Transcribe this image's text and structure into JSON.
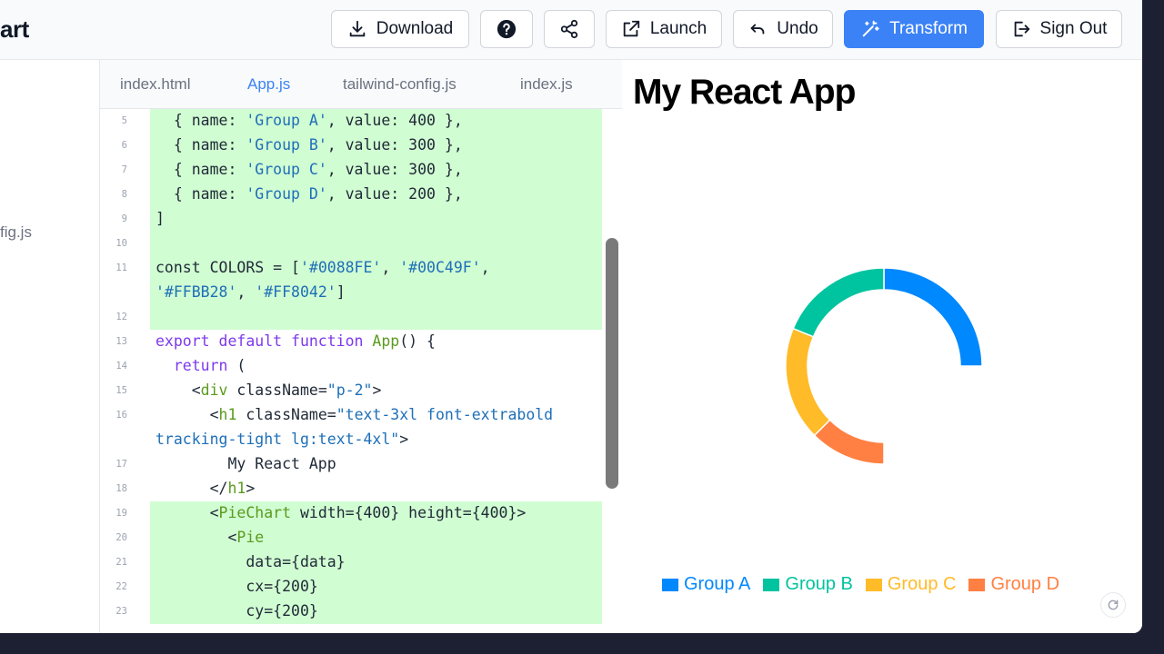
{
  "app": {
    "brand_fragment": "art"
  },
  "toolbar": {
    "download": "Download",
    "launch": "Launch",
    "undo": "Undo",
    "transform": "Transform",
    "sign_out": "Sign Out"
  },
  "sidebar": {
    "file_fragment": "fig.js"
  },
  "tabs": [
    "index.html",
    "App.js",
    "tailwind-config.js",
    "index.js"
  ],
  "active_tab": "App.js",
  "code_lines": [
    {
      "n": "5",
      "hl": true,
      "parts": [
        [
          "p",
          "  { name: "
        ],
        [
          "s",
          "'Group A'"
        ],
        [
          "p",
          ", value: 400 },"
        ]
      ]
    },
    {
      "n": "6",
      "hl": true,
      "parts": [
        [
          "p",
          "  { name: "
        ],
        [
          "s",
          "'Group B'"
        ],
        [
          "p",
          ", value: 300 },"
        ]
      ]
    },
    {
      "n": "7",
      "hl": true,
      "parts": [
        [
          "p",
          "  { name: "
        ],
        [
          "s",
          "'Group C'"
        ],
        [
          "p",
          ", value: 300 },"
        ]
      ]
    },
    {
      "n": "8",
      "hl": true,
      "parts": [
        [
          "p",
          "  { name: "
        ],
        [
          "s",
          "'Group D'"
        ],
        [
          "p",
          ", value: 200 },"
        ]
      ]
    },
    {
      "n": "9",
      "hl": true,
      "parts": [
        [
          "p",
          "]"
        ]
      ]
    },
    {
      "n": "10",
      "hl": true,
      "parts": []
    },
    {
      "n": "11",
      "hl": true,
      "parts": [
        [
          "p",
          "const COLORS = ["
        ],
        [
          "s",
          "'#0088FE'"
        ],
        [
          "p",
          ", "
        ],
        [
          "s",
          "'#00C49F'"
        ],
        [
          "p",
          ","
        ]
      ]
    },
    {
      "n": "",
      "hl": true,
      "parts": [
        [
          "s",
          "'#FFBB28'"
        ],
        [
          "p",
          ", "
        ],
        [
          "s",
          "'#FF8042'"
        ],
        [
          "p",
          "]"
        ]
      ]
    },
    {
      "n": "12",
      "hl": true,
      "parts": []
    },
    {
      "n": "13",
      "hl": false,
      "parts": [
        [
          "k",
          "export default function "
        ],
        [
          "f",
          "App"
        ],
        [
          "p",
          "() {"
        ]
      ]
    },
    {
      "n": "14",
      "hl": false,
      "parts": [
        [
          "k",
          "  return "
        ],
        [
          "p",
          "("
        ]
      ]
    },
    {
      "n": "15",
      "hl": false,
      "parts": [
        [
          "p",
          "    <"
        ],
        [
          "f",
          "div"
        ],
        [
          "p",
          " className="
        ],
        [
          "s",
          "\"p-2\""
        ],
        [
          "p",
          ">"
        ]
      ]
    },
    {
      "n": "16",
      "hl": false,
      "parts": [
        [
          "p",
          "      <"
        ],
        [
          "f",
          "h1"
        ],
        [
          "p",
          " className="
        ],
        [
          "s",
          "\"text-3xl font-extrabold"
        ]
      ]
    },
    {
      "n": "",
      "hl": false,
      "parts": [
        [
          "s",
          "tracking-tight lg:text-4xl\""
        ],
        [
          "p",
          ">"
        ]
      ]
    },
    {
      "n": "17",
      "hl": false,
      "parts": [
        [
          "p",
          "        My React App"
        ]
      ]
    },
    {
      "n": "18",
      "hl": false,
      "parts": [
        [
          "p",
          "      </"
        ],
        [
          "f",
          "h1"
        ],
        [
          "p",
          ">"
        ]
      ]
    },
    {
      "n": "19",
      "hl": true,
      "parts": [
        [
          "p",
          "      <"
        ],
        [
          "f",
          "PieChart"
        ],
        [
          "p",
          " width={400} height={400}>"
        ]
      ]
    },
    {
      "n": "20",
      "hl": true,
      "parts": [
        [
          "p",
          "        <"
        ],
        [
          "f",
          "Pie"
        ]
      ]
    },
    {
      "n": "21",
      "hl": true,
      "parts": [
        [
          "p",
          "          data={data}"
        ]
      ]
    },
    {
      "n": "22",
      "hl": true,
      "parts": [
        [
          "p",
          "          cx={200}"
        ]
      ]
    },
    {
      "n": "23",
      "hl": true,
      "parts": [
        [
          "p",
          "          cy={200}"
        ]
      ]
    }
  ],
  "preview": {
    "title": "My React App",
    "chart": [
      {
        "name": "Group A",
        "value": 400,
        "color": "#0088FE"
      },
      {
        "name": "Group B",
        "value": 300,
        "color": "#00C49F"
      },
      {
        "name": "Group C",
        "value": 300,
        "color": "#FFBB28"
      },
      {
        "name": "Group D",
        "value": 200,
        "color": "#FF8042"
      }
    ]
  }
}
